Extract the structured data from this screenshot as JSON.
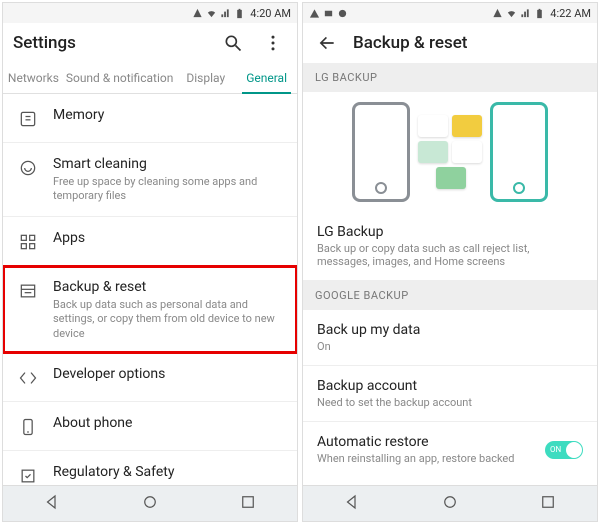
{
  "left": {
    "status": {
      "time": "4:20 AM"
    },
    "header": {
      "title": "Settings"
    },
    "tabs": [
      {
        "label": "Networks",
        "active": false
      },
      {
        "label": "Sound & notification",
        "active": false
      },
      {
        "label": "Display",
        "active": false
      },
      {
        "label": "General",
        "active": true
      }
    ],
    "items": {
      "memory": {
        "title": "Memory"
      },
      "smart_cleaning": {
        "title": "Smart cleaning",
        "subtitle": "Free up space by cleaning some apps and temporary files"
      },
      "apps": {
        "title": "Apps"
      },
      "backup_reset": {
        "title": "Backup & reset",
        "subtitle": "Back up data such as personal data and settings, or copy them from old device to new device"
      },
      "developer": {
        "title": "Developer options"
      },
      "about": {
        "title": "About phone"
      },
      "regulatory": {
        "title": "Regulatory & Safety"
      }
    }
  },
  "right": {
    "status": {
      "time": "4:22 AM"
    },
    "header": {
      "title": "Backup & reset"
    },
    "sections": {
      "lg_backup_header": "LG BACKUP",
      "lg_backup": {
        "title": "LG Backup",
        "subtitle": "Back up or copy data such as call reject list, messages, images, and Home screens"
      },
      "google_backup_header": "GOOGLE BACKUP",
      "backup_my_data": {
        "title": "Back up my data",
        "subtitle": "On"
      },
      "backup_account": {
        "title": "Backup account",
        "subtitle": "Need to set the backup account"
      },
      "automatic_restore": {
        "title": "Automatic restore",
        "subtitle": "When reinstalling an app, restore backed",
        "toggle_label": "ON",
        "toggle_on": true
      }
    }
  }
}
